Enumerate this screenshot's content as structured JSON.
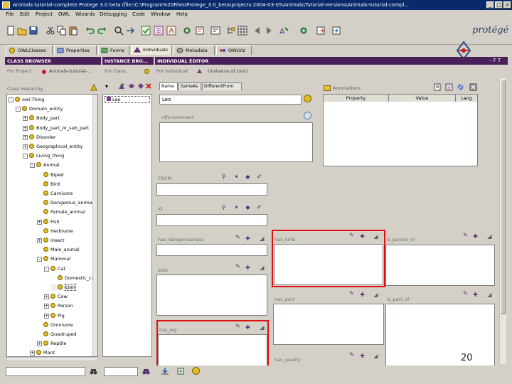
{
  "window": {
    "title": "Animals-tutorial-complete  Protege 3.0 beta   (file:\\C:\\Program%20Files\\Protege_3.0_beta\\projects-2004-03-05\\Animals\\Tutorial-versions\\Animals-tutorial-compl..."
  },
  "menu": [
    "File",
    "Edit",
    "Project",
    "OWL",
    "Wizards",
    "Debugging",
    "Code",
    "Window",
    "Help"
  ],
  "brand": {
    "logo_text": "protégé"
  },
  "tabs": [
    {
      "label": "OWLClasses",
      "icon": "owl-classes-icon",
      "active": false
    },
    {
      "label": "Properties",
      "icon": "properties-icon",
      "active": false
    },
    {
      "label": "Forms",
      "icon": "forms-icon",
      "active": false
    },
    {
      "label": "Individuals",
      "icon": "individuals-icon",
      "active": true
    },
    {
      "label": "Metadata",
      "icon": "metadata-icon",
      "active": false
    },
    {
      "label": "OWLViz",
      "icon": "owlviz-icon",
      "active": false
    }
  ],
  "class_browser": {
    "header": "CLASS BROWSER",
    "for_project_label": "For Project:",
    "project_name": "Animals-tutorial-...",
    "hierarchy_label": "Class Hierarchy",
    "tree": [
      {
        "label": "owl:Thing",
        "depth": 0,
        "expander": "-"
      },
      {
        "label": "Domain_entity",
        "depth": 1,
        "expander": "-"
      },
      {
        "label": "Body_part",
        "depth": 2,
        "expander": "+"
      },
      {
        "label": "Body_part_or_sub_part",
        "depth": 2,
        "expander": "+"
      },
      {
        "label": "Disorder",
        "depth": 2,
        "expander": "+"
      },
      {
        "label": "Geographical_entity",
        "depth": 2,
        "expander": "+"
      },
      {
        "label": "Living_thing",
        "depth": 2,
        "expander": "-"
      },
      {
        "label": "Animal",
        "depth": 3,
        "expander": "-"
      },
      {
        "label": "Biped",
        "depth": 4,
        "expander": ""
      },
      {
        "label": "Bird",
        "depth": 4,
        "expander": ""
      },
      {
        "label": "Carnivore",
        "depth": 4,
        "expander": ""
      },
      {
        "label": "Dangerous_animal",
        "depth": 4,
        "expander": ""
      },
      {
        "label": "Female_animal",
        "depth": 4,
        "expander": ""
      },
      {
        "label": "Fish",
        "depth": 4,
        "expander": "+"
      },
      {
        "label": "Herbivore",
        "depth": 4,
        "expander": ""
      },
      {
        "label": "Insect",
        "depth": 4,
        "expander": "+"
      },
      {
        "label": "Male_animal",
        "depth": 4,
        "expander": ""
      },
      {
        "label": "Mammal",
        "depth": 4,
        "expander": "-"
      },
      {
        "label": "Cat",
        "depth": 5,
        "expander": "-"
      },
      {
        "label": "Domestic_cat",
        "depth": 6,
        "expander": ""
      },
      {
        "label": "Lion",
        "depth": 6,
        "expander": "",
        "selected": true
      },
      {
        "label": "Cow",
        "depth": 5,
        "expander": "+"
      },
      {
        "label": "Person",
        "depth": 5,
        "expander": "+"
      },
      {
        "label": "Pig",
        "depth": 5,
        "expander": "+"
      },
      {
        "label": "Omnivore",
        "depth": 4,
        "expander": ""
      },
      {
        "label": "Quadruped",
        "depth": 4,
        "expander": ""
      },
      {
        "label": "Reptile",
        "depth": 4,
        "expander": "+"
      },
      {
        "label": "Plant",
        "depth": 3,
        "expander": "+"
      }
    ]
  },
  "instance_browser": {
    "header": "INSTANCE BRO...",
    "for_class_label": "For Class:",
    "instances": [
      "Leo"
    ]
  },
  "individual_editor": {
    "header": "INDIVIDUAL EDITOR",
    "for_individual_label": "For Individual:",
    "individual_name": "(instance of Lion)",
    "subtabs": [
      "Name",
      "SameAs",
      "DifferentFrom"
    ],
    "name_value": "Leo",
    "rdfs_comment_label": "rdfs:comment",
    "annotations": {
      "title": "Annotations",
      "columns": [
        "Property",
        "Value",
        "Lang"
      ]
    },
    "slots": {
      "from": "FROM",
      "id": "ID",
      "has_dangerousness": "has_dangerousness",
      "eats": "eats",
      "has_leg": "has_leg",
      "has_limb": "has_limb",
      "is_parent_of": "is_parent_of",
      "has_part": "has_part",
      "is_part_of": "is_part_of",
      "has_quality": "has_quality"
    },
    "highlight_color": "#e01010"
  },
  "slide_number": "20"
}
